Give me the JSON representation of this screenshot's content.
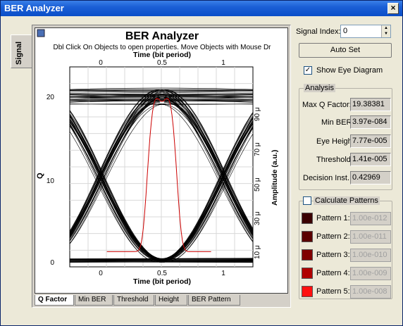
{
  "window": {
    "title": "BER Analyzer",
    "close_symbol": "×"
  },
  "left_tab": {
    "label": "Signal"
  },
  "plot": {
    "title": "BER Analyzer",
    "subtitle": "Dbl Click On Objects to open properties.  Move Objects with Mouse Dr",
    "top_axis_label": "Time (bit period)",
    "bottom_axis_label": "Time (bit period)",
    "left_axis_label": "Q",
    "right_axis_label": "Amplitude (a.u.)",
    "top_ticks": [
      "0",
      "0.5",
      "1"
    ],
    "bottom_ticks": [
      "0",
      "0.5",
      "1"
    ],
    "left_ticks": [
      "20",
      "10",
      "0"
    ],
    "right_ticks": [
      "90 μ",
      "70 μ",
      "50 μ",
      "30 μ",
      "10 μ"
    ],
    "colors": {
      "eye": "#000000",
      "q_curve": "#cc0000"
    }
  },
  "bottom_tabs": [
    "Q Factor",
    "Min BER",
    "Threshold",
    "Height",
    "BER Pattern"
  ],
  "right_panel": {
    "signal_index_label": "Signal Index:",
    "signal_index_value": "0",
    "auto_set_label": "Auto Set",
    "show_eye_label": "Show Eye Diagram",
    "show_eye_checked": "✓",
    "analysis_group_label": "Analysis",
    "analysis": [
      {
        "label": "Max Q Factor:",
        "value": "19.38381"
      },
      {
        "label": "Min BER:",
        "value": "3.97e-084"
      },
      {
        "label": "Eye Height:",
        "value": "7.77e-005"
      },
      {
        "label": "Threshold:",
        "value": "1.41e-005"
      },
      {
        "label": "Decision Inst.:",
        "value": "0.42969"
      }
    ],
    "calc_patterns_label": "Calculate Patterns",
    "patterns": [
      {
        "label": "Pattern 1:",
        "value": "1.00e-012",
        "color": "#3a0000"
      },
      {
        "label": "Pattern 2:",
        "value": "1.00e-011",
        "color": "#5a0000"
      },
      {
        "label": "Pattern 3:",
        "value": "1.00e-010",
        "color": "#800000"
      },
      {
        "label": "Pattern 4:",
        "value": "1.00e-009",
        "color": "#b00000"
      },
      {
        "label": "Pattern 5:",
        "value": "1.00e-008",
        "color": "#ff1010"
      }
    ]
  }
}
